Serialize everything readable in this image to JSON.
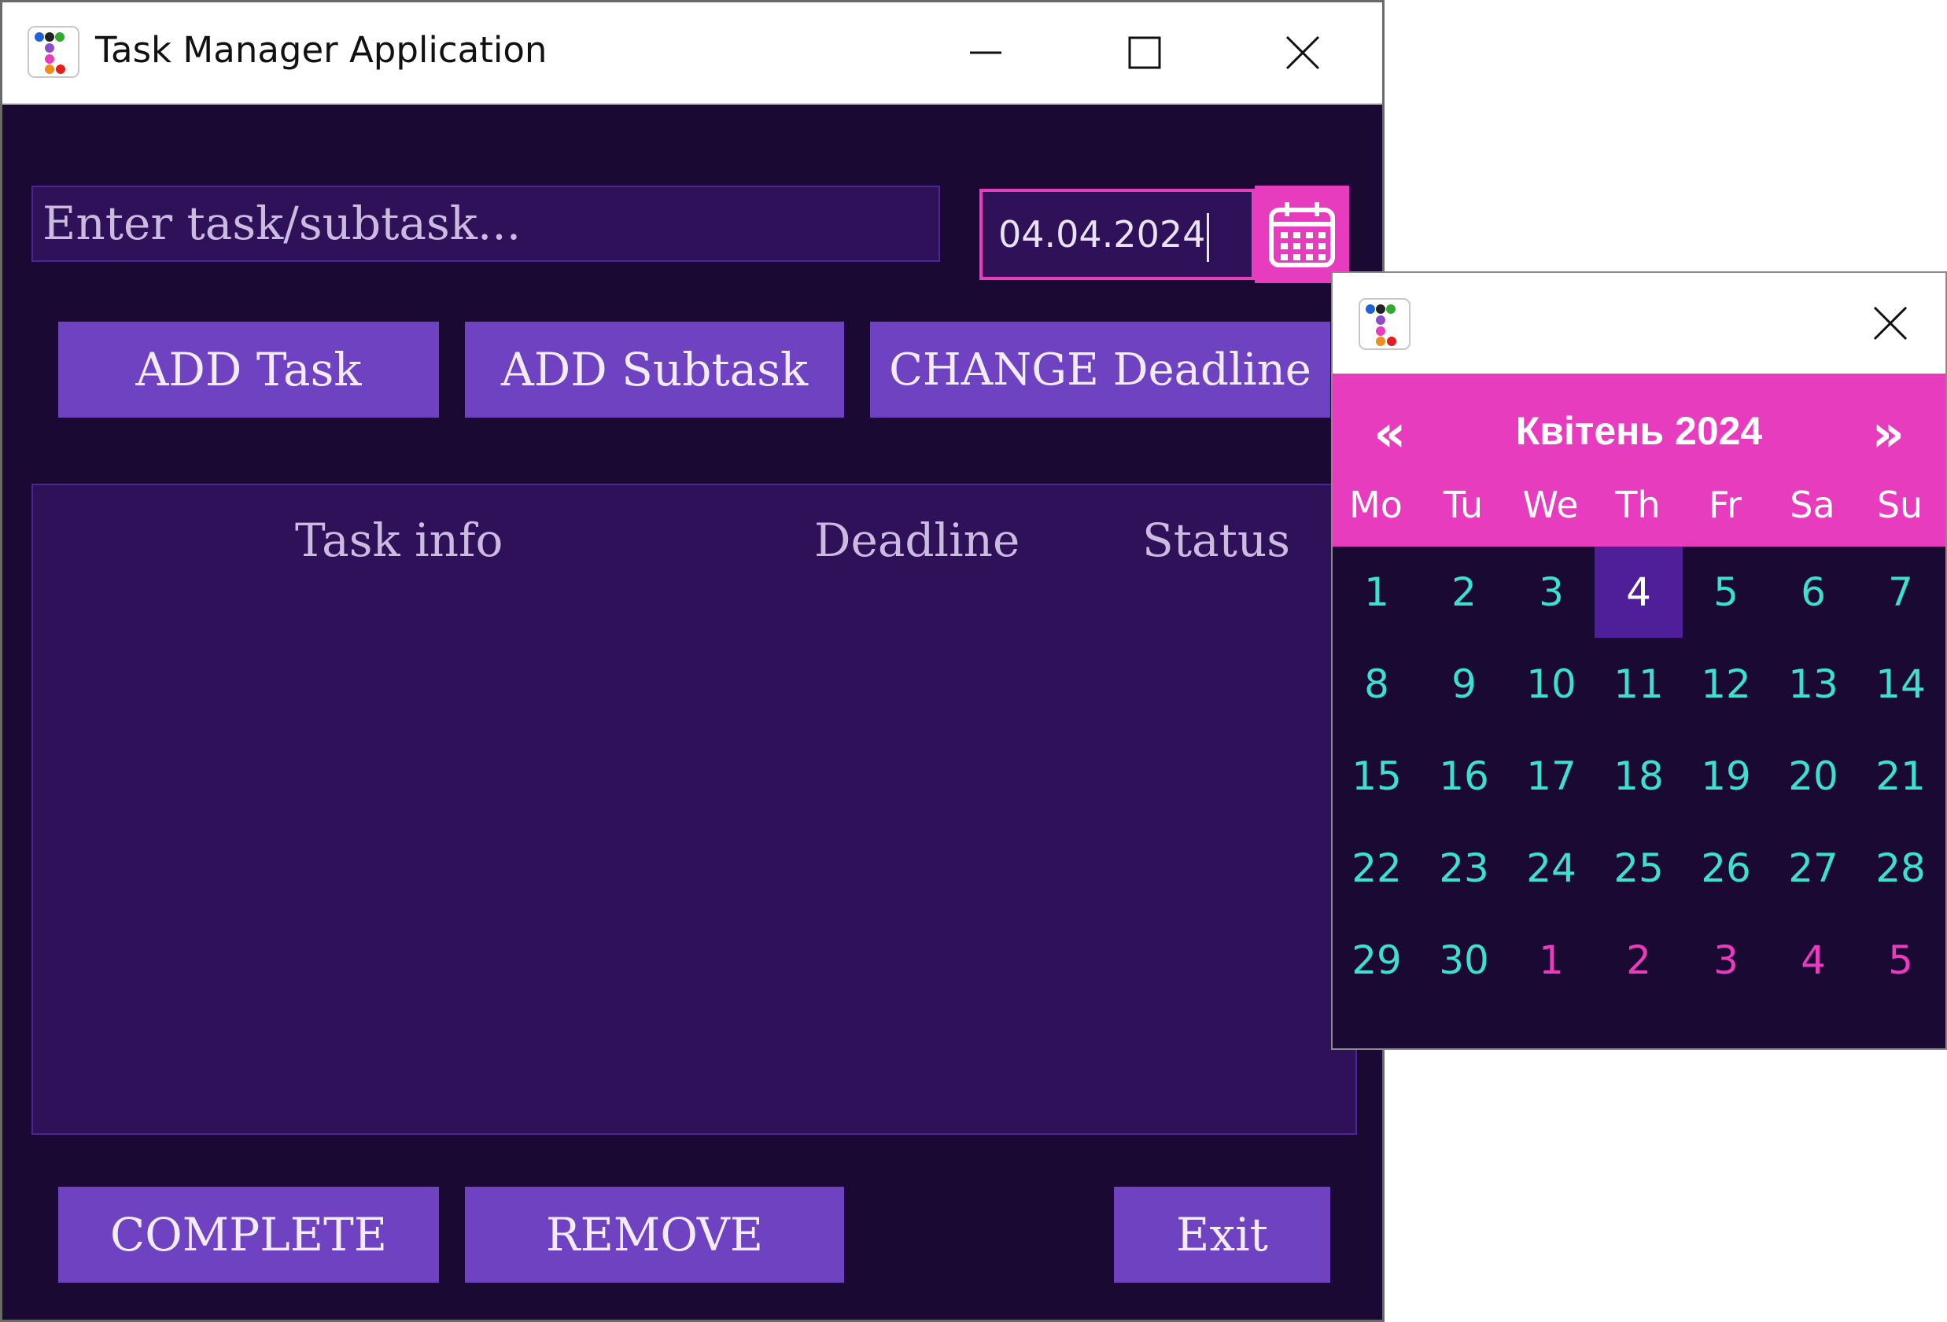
{
  "window": {
    "title": "Task Manager Application",
    "minimize_glyph": "—",
    "maximize_glyph": "☐",
    "close_glyph": "✕"
  },
  "task_input": {
    "placeholder": "Enter task/subtask..."
  },
  "date_input": {
    "value": "04.04.2024"
  },
  "buttons": {
    "add_task": "ADD Task",
    "add_subtask": "ADD Subtask",
    "change_deadline": "CHANGE Deadline",
    "complete": "COMPLETE",
    "remove": "REMOVE",
    "exit": "Exit"
  },
  "table": {
    "columns": [
      "Task info",
      "Deadline",
      "Status"
    ],
    "rows": []
  },
  "calendar_popup": {
    "prev_glyph": "«",
    "next_glyph": "»",
    "month_label": "Квітень 2024",
    "weekdays": [
      "Mo",
      "Tu",
      "We",
      "Th",
      "Fr",
      "Sa",
      "Su"
    ],
    "weeks": [
      [
        "1",
        "2",
        "3",
        "4",
        "5",
        "6",
        "7"
      ],
      [
        "8",
        "9",
        "10",
        "11",
        "12",
        "13",
        "14"
      ],
      [
        "15",
        "16",
        "17",
        "18",
        "19",
        "20",
        "21"
      ],
      [
        "22",
        "23",
        "24",
        "25",
        "26",
        "27",
        "28"
      ],
      [
        "29",
        "30",
        "1",
        "2",
        "3",
        "4",
        "5"
      ]
    ],
    "selected_day": "4",
    "next_month_days_in_last_week": 5
  },
  "colors": {
    "background": "#1a0a33",
    "panel": "#2e1158",
    "button": "#6f42c1",
    "accent_pink": "#e83cbf",
    "day_text": "#3be0d0",
    "selected_day_bg": "#4f1f9a"
  },
  "icons": {
    "app_icon": "app-dots-icon",
    "calendar_icon": "calendar-icon"
  }
}
